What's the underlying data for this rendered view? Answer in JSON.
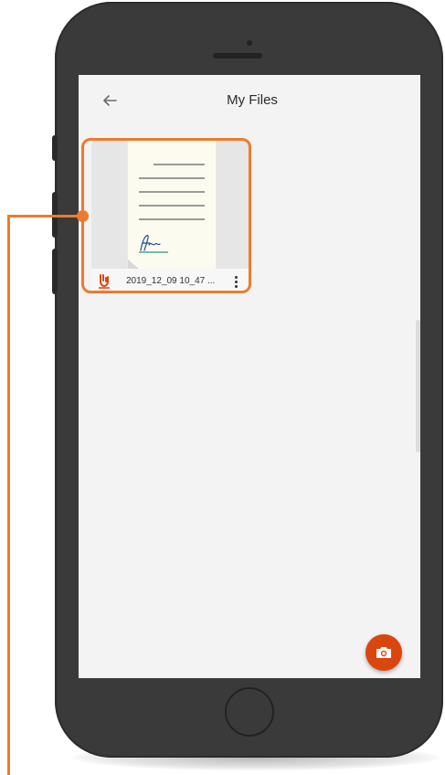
{
  "header": {
    "title": "My Files",
    "back_icon": "arrow-left-icon"
  },
  "files": [
    {
      "name": "2019_12_09 10_47 ...",
      "type_icon": "pdf-icon",
      "menu_icon": "more-vert-icon"
    }
  ],
  "fab": {
    "icon": "camera-icon"
  },
  "colors": {
    "accent": "#d9470f",
    "highlight": "#ee7b2d",
    "screen_bg": "#f3f3f3",
    "device": "#3a3a3a"
  }
}
